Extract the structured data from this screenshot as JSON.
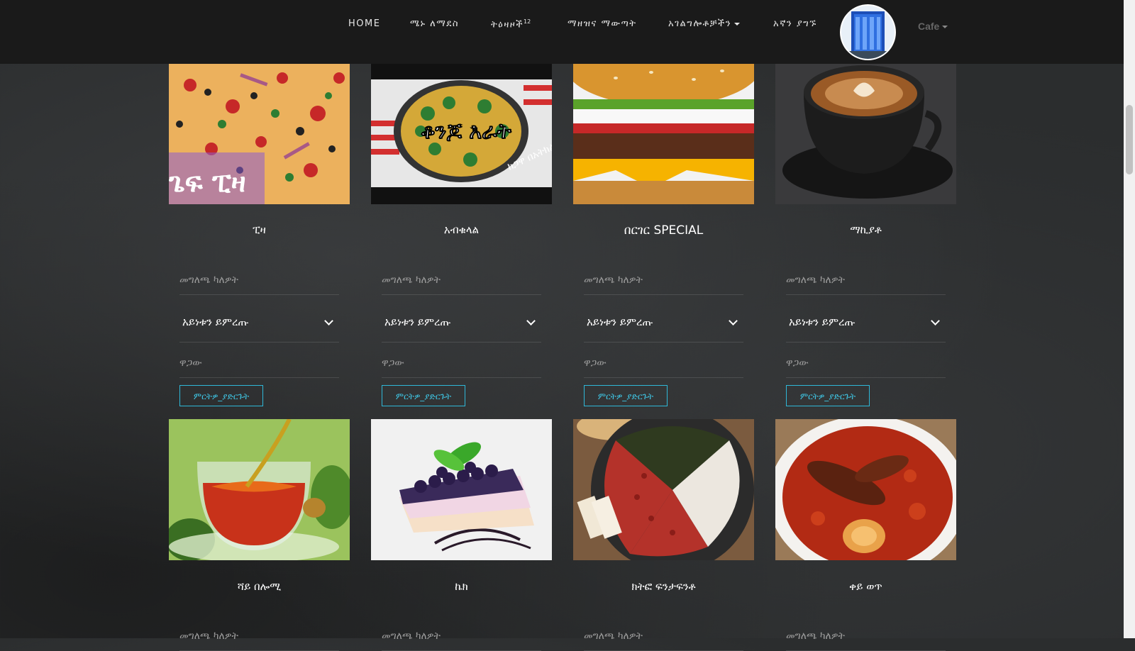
{
  "nav": {
    "home": "HOME",
    "about": "ሜኑ ለማደስ",
    "orders": "ትዕዛዞች",
    "orders_count": "12",
    "report": "ማዘዝና ማውጣት",
    "services": "አገልግሎቶቻችን",
    "contact": "አኛን ያግኙ",
    "cafe": "Cafe"
  },
  "card_labels": {
    "quantity_placeholder": "መግለጫ ካለዎት",
    "type_select": "አይነቱን ይምረጡ",
    "price_placeholder": "ዋጋው",
    "order_button": "ምርትዎ_ያድርጉት"
  },
  "products": [
    {
      "name": "ፒዛ",
      "image_overlay": "ጌፍ ፒዛ"
    },
    {
      "name": "አብቁላል",
      "image_overlay": "ቆንጆ እራት",
      "image_overlay2": "ከጋዋ በአትክልት"
    },
    {
      "name": "በርገር SPECIAL"
    },
    {
      "name": "ማኪያቶ"
    },
    {
      "name": "ሻይ በሎሚ"
    },
    {
      "name": "ኬክ"
    },
    {
      "name": "ክትፎ ፍንታፍንቶ"
    },
    {
      "name": "ቀይ ወጥ"
    }
  ],
  "colors": {
    "navbar": "#1a1a1a",
    "accent": "#3fc7e6",
    "background": "#2b2d2e"
  }
}
